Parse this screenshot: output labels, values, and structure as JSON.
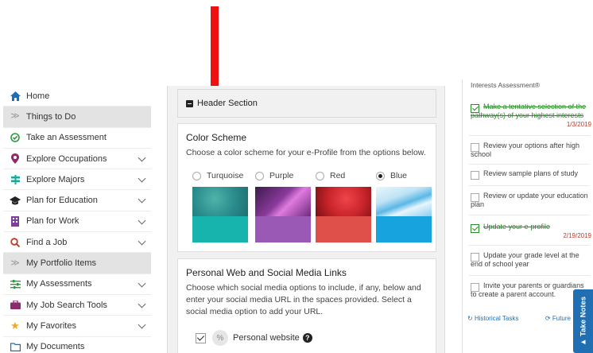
{
  "sidebar": {
    "items": [
      {
        "label": "Home",
        "icon": "home-icon",
        "color": "#1f6fb2"
      },
      {
        "label": "Things to Do",
        "icon": "double-chevron-icon",
        "color": "#999999"
      },
      {
        "label": "Take an Assessment",
        "icon": "check-circle-icon",
        "color": "#2a9d3f"
      },
      {
        "label": "Explore Occupations",
        "icon": "map-pin-icon",
        "color": "#8e2b6e"
      },
      {
        "label": "Explore Majors",
        "icon": "signpost-icon",
        "color": "#1aa898"
      },
      {
        "label": "Plan for Education",
        "icon": "graduation-cap-icon",
        "color": "#222222"
      },
      {
        "label": "Plan for Work",
        "icon": "building-icon",
        "color": "#7b3f98"
      },
      {
        "label": "Find a Job",
        "icon": "search-icon",
        "color": "#c0392b"
      },
      {
        "label": "My Portfolio Items",
        "icon": "double-chevron-icon",
        "color": "#999999"
      },
      {
        "label": "My Assessments",
        "icon": "sliders-icon",
        "color": "#2a9d3f"
      },
      {
        "label": "My Job Search Tools",
        "icon": "briefcase-icon",
        "color": "#8e2b6e"
      },
      {
        "label": "My Favorites",
        "icon": "star-icon",
        "color": "#f5a623"
      },
      {
        "label": "My Documents",
        "icon": "folder-icon",
        "color": "#1f6fb2"
      }
    ]
  },
  "main": {
    "header_section_label": "Header Section",
    "color_scheme": {
      "title": "Color Scheme",
      "description": "Choose a color scheme for your e-Profile from the options below.",
      "options": [
        {
          "name": "Turquoise",
          "selected": false,
          "top": "#2a8b8c",
          "bottom": "#17b3ad"
        },
        {
          "name": "Purple",
          "selected": false,
          "top": "#8a3a9c",
          "bottom": "#9b59b6"
        },
        {
          "name": "Red",
          "selected": false,
          "top": "#c9252b",
          "bottom": "#e0504a"
        },
        {
          "name": "Blue",
          "selected": true,
          "top": "#bfe3f5",
          "bottom": "#17a3dd"
        }
      ]
    },
    "social": {
      "title": "Personal Web and Social Media Links",
      "description": "Choose which social media options to include, if any, below and enter your social media URL in the spaces provided. Select a social media option to add your URL.",
      "website_label": "Personal website",
      "help_glyph": "?"
    }
  },
  "tasks": {
    "top_note": "Interests Assessment®",
    "items": [
      {
        "text": "Make a tentative selection of the pathway(s) of your highest interests",
        "done": true,
        "date": "1/3/2019"
      },
      {
        "text": "Review your options after high school",
        "done": false,
        "date": ""
      },
      {
        "text": "Review sample plans of study",
        "done": false,
        "date": ""
      },
      {
        "text": "Review or update your education plan",
        "done": false,
        "date": ""
      },
      {
        "text": "Update your e-profile",
        "done": true,
        "date": "2/19/2019"
      },
      {
        "text": "Update your grade level at the end of school year",
        "done": false,
        "date": ""
      },
      {
        "text": "Invite your parents or guardians to create a parent account.",
        "done": false,
        "date": ""
      }
    ],
    "historical_label": "Historical Tasks",
    "future_label": "Future"
  },
  "take_notes_label": "Take Notes"
}
